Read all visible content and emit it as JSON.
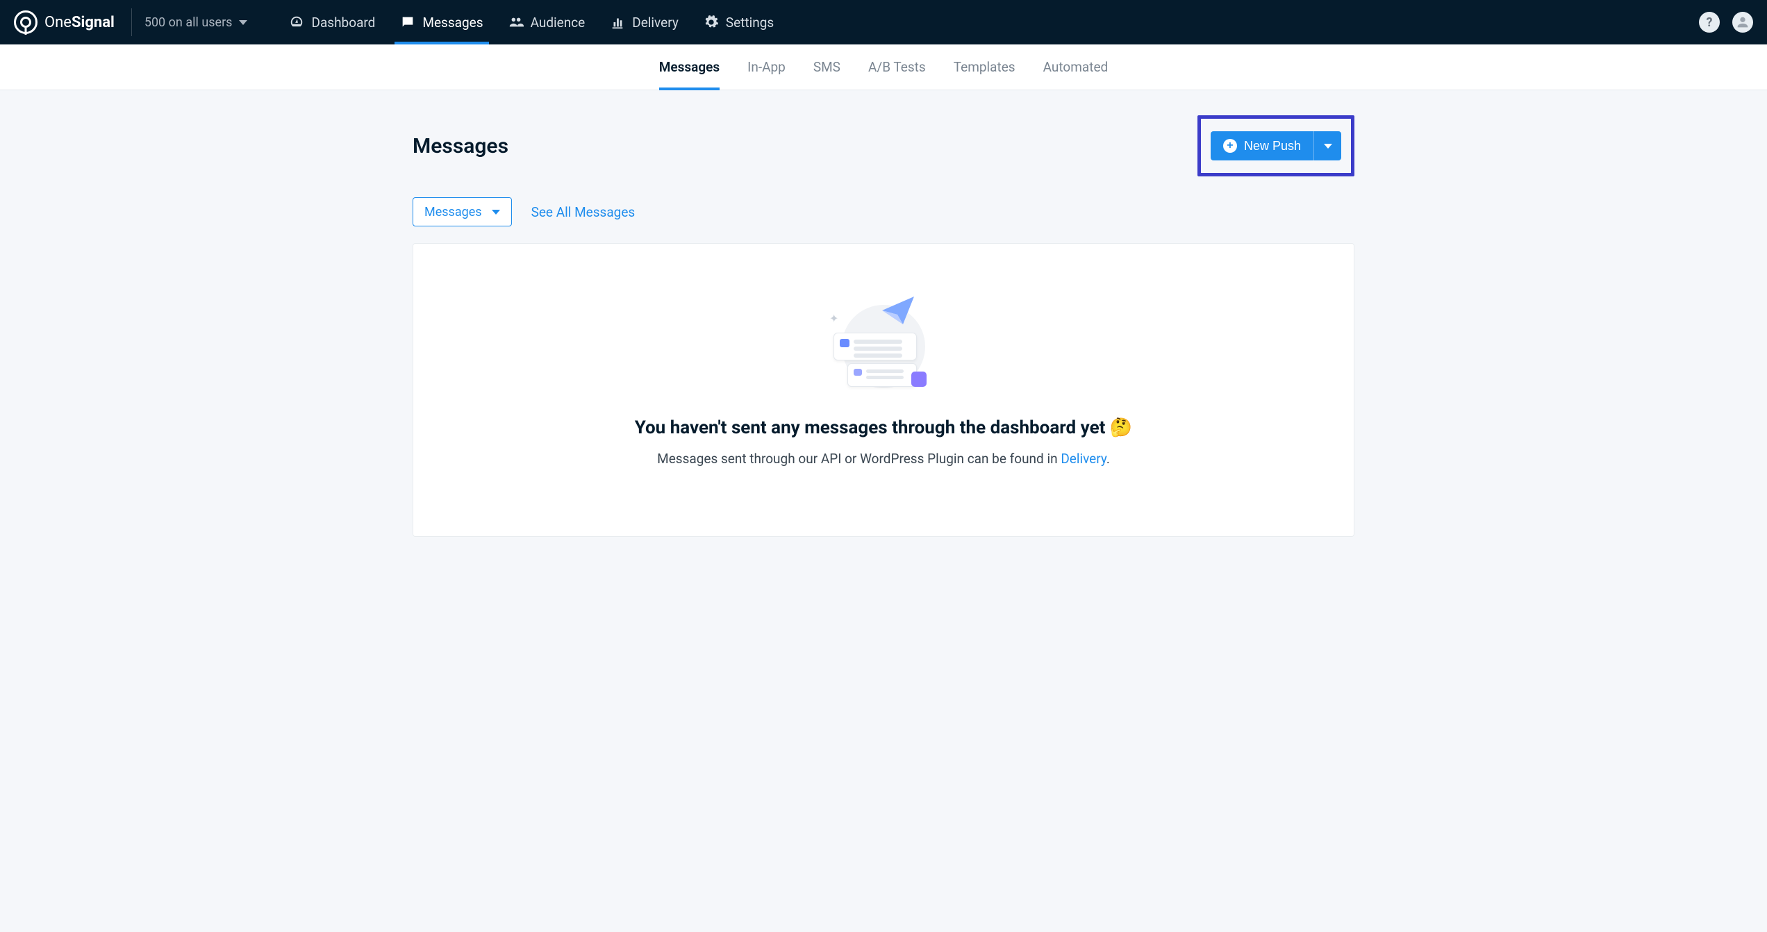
{
  "brand": {
    "name_light": "One",
    "name_bold": "Signal"
  },
  "app_switcher": {
    "label": "500 on all users"
  },
  "top_nav": {
    "dashboard": "Dashboard",
    "messages": "Messages",
    "audience": "Audience",
    "delivery": "Delivery",
    "settings": "Settings"
  },
  "sub_nav": {
    "messages": "Messages",
    "in_app": "In-App",
    "sms": "SMS",
    "ab_tests": "A/B Tests",
    "templates": "Templates",
    "automated": "Automated"
  },
  "page": {
    "title": "Messages",
    "new_push_label": "New Push",
    "filter_label": "Messages",
    "see_all_link": "See All Messages",
    "empty_title": "You haven't sent any messages through the dashboard yet 🤔",
    "empty_sub_before": "Messages sent through our API or WordPress Plugin can be found in ",
    "empty_sub_link": "Delivery",
    "empty_sub_after": "."
  }
}
